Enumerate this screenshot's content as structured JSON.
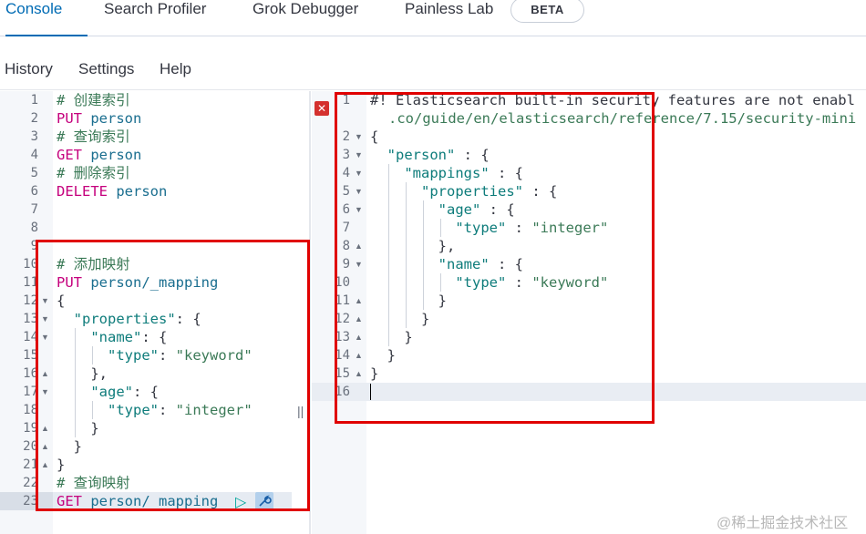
{
  "tabs": [
    {
      "label": "Console",
      "active": true
    },
    {
      "label": "Search Profiler"
    },
    {
      "label": "Grok Debugger"
    },
    {
      "label": "Painless Lab"
    }
  ],
  "beta_badge": "BETA",
  "subnav": {
    "history": "History",
    "settings": "Settings",
    "help": "Help"
  },
  "left_editor": {
    "line_numbers": [
      "1",
      "2",
      "3",
      "4",
      "5",
      "6",
      "7",
      "8",
      "9",
      "10",
      "11",
      "12",
      "13",
      "14",
      "15",
      "16",
      "17",
      "18",
      "19",
      "20",
      "21",
      "22",
      "23"
    ],
    "active_line": "23"
  },
  "right_editor": {
    "line_numbers": [
      "1",
      "2",
      "3",
      "4",
      "5",
      "6",
      "7",
      "8",
      "9",
      "10",
      "11",
      "12",
      "13",
      "14",
      "15",
      "16"
    ],
    "warning_line1": "#! Elasticsearch built-in security features are not enabl",
    "warning_line2": ".co/guide/en/elasticsearch/reference/7.15/security-mini"
  },
  "colors": {
    "accent": "#006bb4",
    "highlight_box": "#e00000",
    "error_icon": "#d4312e"
  },
  "icons": [
    "error-x-icon",
    "play-icon",
    "wrench-icon",
    "resize-handle-icon"
  ],
  "watermark": "@稀土掘金技术社区"
}
